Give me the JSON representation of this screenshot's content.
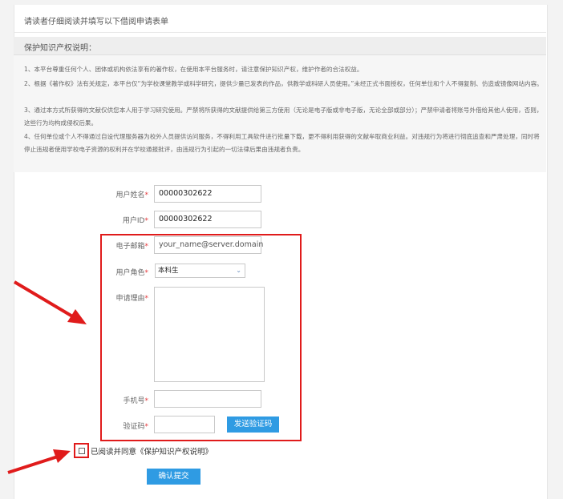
{
  "header": {
    "title": "请读者仔细阅读并填写以下借阅申请表单"
  },
  "section": {
    "title": "保护知识产权说明："
  },
  "notice": {
    "items": [
      "1、本平台尊重任何个人、团体或机构依法享有的著作权，在使用本平台服务时，请注意保护知识产权，维护作者的合法权益。",
      "2、根据《著作权》法有关规定，本平台仅“为学校课堂教学或科学研究，提供少量已发表的作品，供教学或科研人员使用。”未经正式书面授权，任何单位和个人不得复制、仿造或镜像网站内容。",
      "3、通过本方式所获得的文献仅供您本人用于学习研究使用。严禁将所获得的文献提供给第三方使用（无论是电子版或非电子版，无论全部或部分）；严禁申请者将账号外借给其他人使用，否则，这些行为均构成侵权后果。",
      "4、任何单位或个人不得通过自设代理服务器为校外人员提供访问服务，不得利用工具软件进行批量下载，更不得利用获得的文献牟取商业利益。对违规行为将进行彻底追查和严肃处理，同时将停止违规者使用学校电子资源的权利并在学校通报批评，由违规行为引起的一切法律后果由违规者负责。"
    ]
  },
  "form": {
    "name_label": "用户姓名",
    "name_value": "00000302622",
    "id_label": "用户ID",
    "id_value": "00000302622",
    "email_label": "电子邮箱",
    "email_placeholder": "your_name@server.domain",
    "role_label": "用户角色",
    "role_value": "本科生",
    "reason_label": "申请理由",
    "phone_label": "手机号",
    "code_label": "验证码",
    "required_mark": "*",
    "send_code_label": "发送验证码",
    "agree_label": "已阅读并同意《保护知识产权说明》",
    "submit_label": "确认提交"
  },
  "annotation": {
    "color": "#e01b1b"
  }
}
